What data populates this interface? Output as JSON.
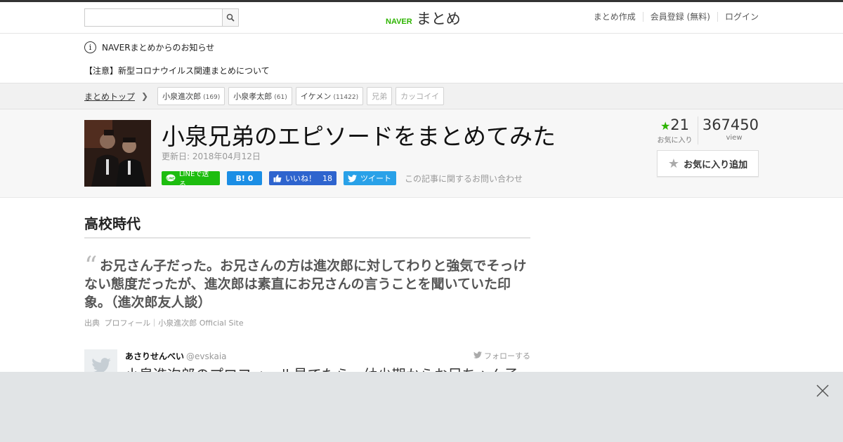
{
  "header": {
    "search_placeholder": "",
    "logo_naver": "NAVER",
    "logo_matome": "まとめ",
    "nav": [
      "まとめ作成",
      "会員登録 (無料)",
      "ログイン"
    ]
  },
  "notice": {
    "title": "NAVERまとめからのお知らせ",
    "link": "【注意】新型コロナウイルス関連まとめについて"
  },
  "breadcrumb": {
    "top": "まとめトップ",
    "tags": [
      {
        "label": "小泉進次郎",
        "count": "(169)"
      },
      {
        "label": "小泉孝太郎",
        "count": "(61)"
      },
      {
        "label": "イケメン",
        "count": "(11422)"
      },
      {
        "label": "兄弟",
        "count": ""
      },
      {
        "label": "カッコイイ",
        "count": ""
      }
    ]
  },
  "article": {
    "title": "小泉兄弟のエピソードをまとめてみた",
    "updated": "更新日: 2018年04月12日",
    "share": {
      "line": "LINEで送る",
      "hatena": "B! 0",
      "fb_like": "いいね！",
      "fb_count": "18",
      "tweet": "ツイート"
    },
    "contact": "この記事に関するお問い合わせ",
    "favorites": "21",
    "favorites_label": "お気に入り",
    "views": "367450",
    "views_label": "view",
    "fav_button": "お気に入り追加"
  },
  "content": {
    "heading": "高校時代",
    "quote": "お兄さん子だった。お兄さんの方は進次郎に対してわりと強気でそっけない態度だったが、進次郎は素直にお兄さんの言うことを聞いていた印象。（進次郎友人談）",
    "source_label": "出典",
    "source_text": "プロフィール｜小泉進次郎 Official Site",
    "tweet": {
      "name": "あさりせんべい",
      "handle": "@evskaia",
      "follow": "フォローする",
      "body": "小泉進次郎のプロフィール見てたら、幼少期からお兄ちゃん子"
    }
  },
  "colors": {
    "naver_green": "#2db400",
    "line_green": "#1dbd0f",
    "hatena_blue": "#1b8ee5",
    "facebook_blue": "#2e64ce",
    "twitter_blue": "#29a1e8"
  }
}
